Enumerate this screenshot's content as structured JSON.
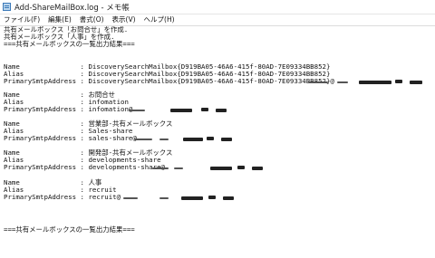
{
  "window": {
    "title": "Add-ShareMailBox.log - メモ帳"
  },
  "menu": [
    {
      "label": "ファイル(F)"
    },
    {
      "label": "編集(E)"
    },
    {
      "label": "書式(O)"
    },
    {
      "label": "表示(V)"
    },
    {
      "label": "ヘルプ(H)"
    }
  ],
  "log_lines": [
    "共有メールボックス「お問合せ」を作成.",
    "共有メールボックス「人事」を作成.",
    "===共有メールボックスの一覧出力結果===",
    "",
    "",
    "Name               : DiscoverySearchMailbox{D919BA05-46A6-415f-80AD-7E09334BB852}",
    "Alias              : DiscoverySearchMailbox{D919BA05-46A6-415f-80AD-7E09334BB852}",
    "PrimarySmtpAddress : DiscoverySearchMailbox{D919BA05-46A6-415f-80AD-7E09334BB852}@",
    "",
    "Name               : お問合せ",
    "Alias              : infomation",
    "PrimarySmtpAddress : infomation@",
    "",
    "Name               : 営業部-共有メールボックス",
    "Alias              : Sales-share",
    "PrimarySmtpAddress : sales-share@",
    "",
    "Name               : 開発部-共有メールボックス",
    "Alias              : developments-share",
    "PrimarySmtpAddress : developments-share@",
    "",
    "Name               : 人事",
    "Alias              : recruit",
    "PrimarySmtpAddress : recruit@",
    "",
    "",
    "",
    "===共有メールボックスの一覧出力結果==="
  ]
}
